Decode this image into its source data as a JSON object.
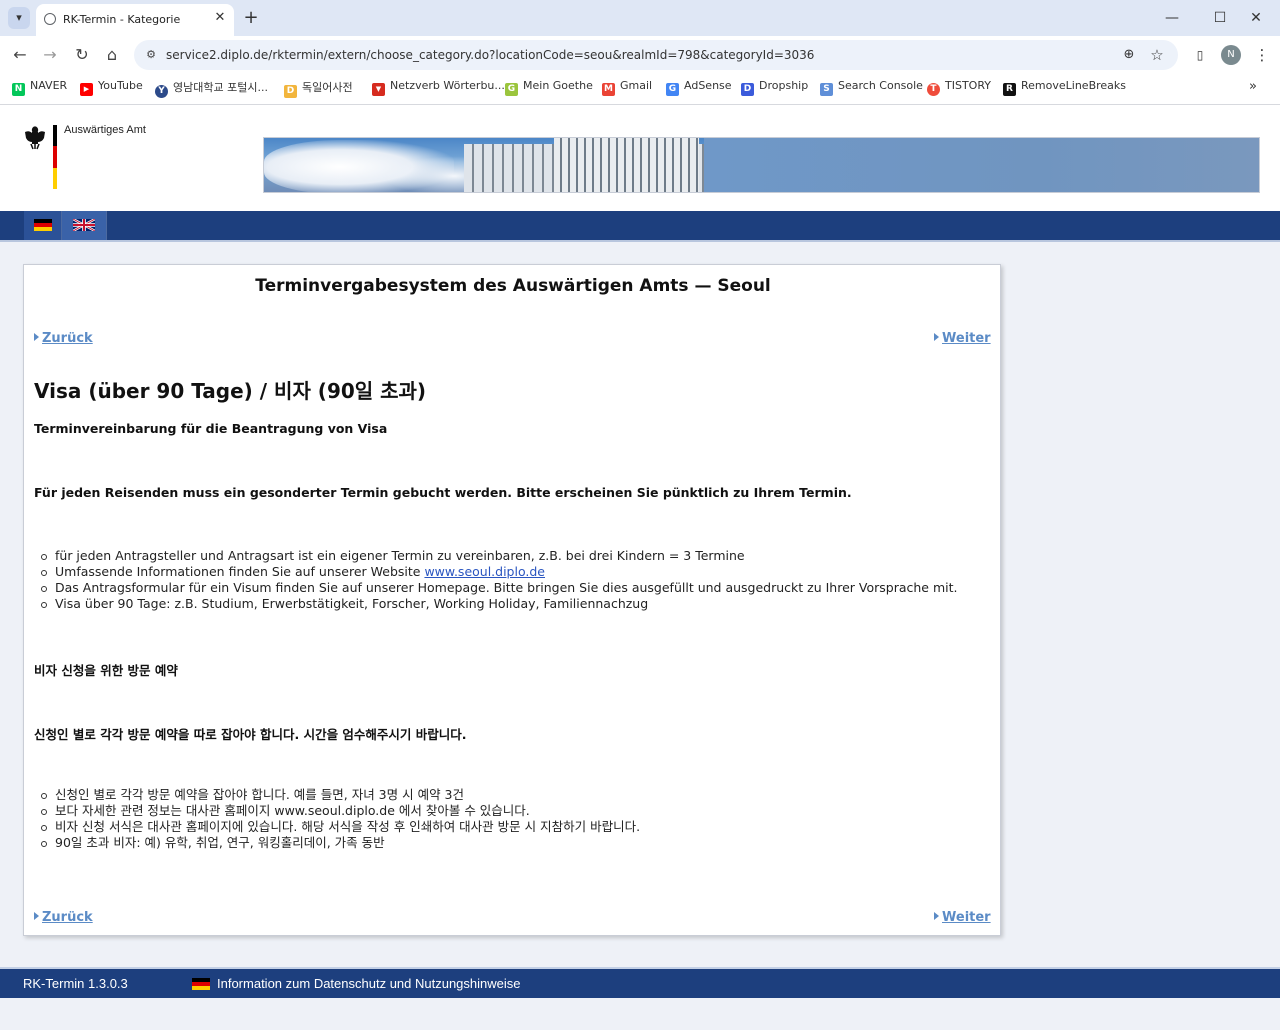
{
  "browser": {
    "tab_title": "RK-Termin - Kategorie",
    "tab_close": "✕",
    "new_tab": "+",
    "url": "service2.diplo.de/rktermin/extern/choose_category.do?locationCode=seou&realmId=798&categoryId=3036",
    "profile_initial": "N",
    "bookmarks": [
      {
        "label": "NAVER",
        "icon": "naver-icon",
        "color": "#03c75a",
        "glyph": "N"
      },
      {
        "label": "YouTube",
        "icon": "youtube-icon",
        "color": "#ff0000",
        "glyph": "▶"
      },
      {
        "label": "영남대학교 포털시...",
        "icon": "yeungnam-icon",
        "color": "#2c4a8a",
        "glyph": "Y"
      },
      {
        "label": "독일어사전",
        "icon": "dictionary-icon",
        "color": "#f2b53c",
        "glyph": "D"
      },
      {
        "label": "Netzverb Wörterbu...",
        "icon": "netzverb-icon",
        "color": "#d62b1f",
        "glyph": "▼"
      },
      {
        "label": "Mein Goethe",
        "icon": "goethe-icon",
        "color": "#9bc53d",
        "glyph": "G"
      },
      {
        "label": "Gmail",
        "icon": "gmail-icon",
        "color": "#ea4335",
        "glyph": "M"
      },
      {
        "label": "AdSense",
        "icon": "adsense-icon",
        "color": "#4285f4",
        "glyph": "G"
      },
      {
        "label": "Dropship",
        "icon": "dropship-icon",
        "color": "#3b5bdb",
        "glyph": "D"
      },
      {
        "label": "Search Console",
        "icon": "search-console-icon",
        "color": "#5f8fd8",
        "glyph": "S"
      },
      {
        "label": "TISTORY",
        "icon": "tistory-icon",
        "color": "#ef4c3b",
        "glyph": "T"
      },
      {
        "label": "RemoveLineBreaks",
        "icon": "removelinebreaks-icon",
        "color": "#111111",
        "glyph": "R"
      }
    ]
  },
  "header": {
    "agency_name": "Auswärtiges Amt",
    "flag_colors": [
      "#000000",
      "#dd0000",
      "#ffce00"
    ]
  },
  "page": {
    "title": "Terminvergabesystem des Auswärtigen Amts — Seoul",
    "back_label": "Zurück",
    "next_label": "Weiter",
    "category_title": "Visa (über 90 Tage) / 비자 (90일 초과)",
    "de_heading": "Terminvereinbarung für die Beantragung von Visa",
    "de_notice": "Für jeden Reisenden muss ein gesonderter Termin gebucht werden. Bitte erscheinen Sie pünktlich zu Ihrem Termin.",
    "de_list": {
      "item1": "für jeden Antragsteller und Antragsart ist ein eigener Termin zu vereinbaren, z.B. bei drei Kindern = 3 Termine",
      "item2_prefix": "Umfassende Informationen finden Sie auf unserer Website ",
      "item2_link": "www.seoul.diplo.de",
      "item3": "Das Antragsformular für ein Visum finden Sie auf unserer Homepage. Bitte bringen Sie dies ausgefüllt und ausgedruckt zu Ihrer Vorsprache mit.",
      "item4": "Visa über 90 Tage: z.B. Studium, Erwerbstätigkeit, Forscher, Working Holiday, Familiennachzug"
    },
    "ko_heading": "비자 신청을 위한 방문 예약",
    "ko_notice": "신청인 별로 각각 방문 예약을 따로 잡아야 합니다. 시간을 엄수해주시기 바랍니다.",
    "ko_list": [
      "신청인 별로 각각 방문 예약을 잡아야 합니다.  예를 들면, 자녀 3명 시 예약 3건",
      "보다 자세한 관련 정보는 대사관 홈페이지 www.seoul.diplo.de 에서 찾아볼 수 있습니다.",
      "비자 신청 서식은 대사관 홈페이지에 있습니다. 해당 서식을 작성 후 인쇄하여 대사관 방문 시 지참하기 바랍니다.",
      "90일 초과 비자: 예) 유학, 취업, 연구, 워킹홀리데이, 가족 동반"
    ]
  },
  "footer": {
    "version": "RK-Termin 1.3.0.3",
    "privacy_link": "Information zum Datenschutz und Nutzungshinweise"
  },
  "colors": {
    "nav_blue": "#1d3f7e",
    "link_blue": "#5b8bc6"
  }
}
